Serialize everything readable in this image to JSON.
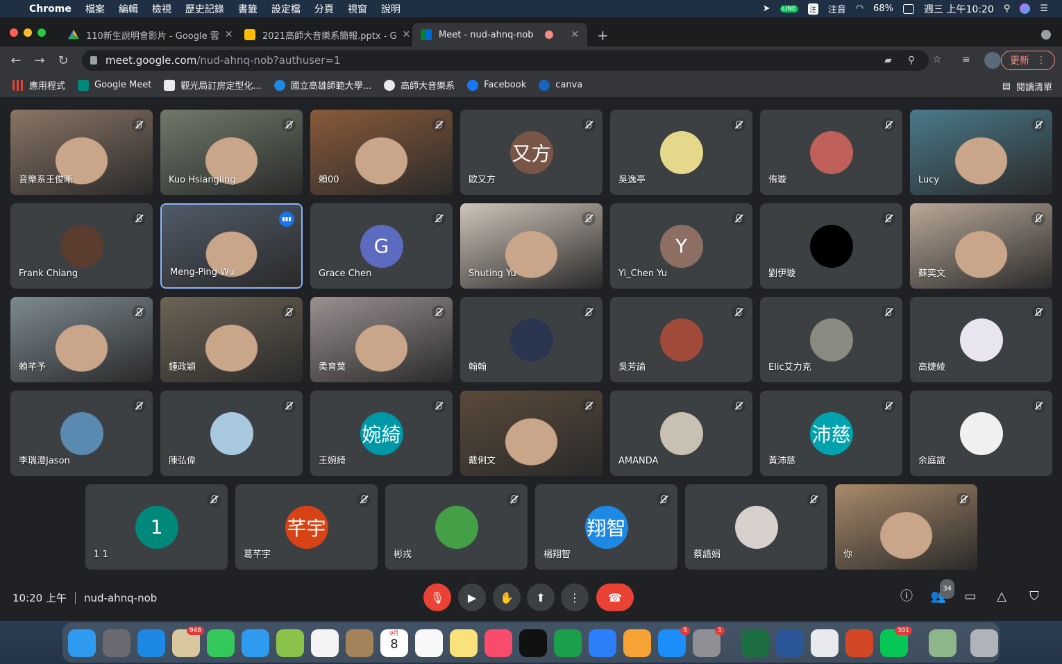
{
  "menubar": {
    "app": "Chrome",
    "menus": [
      "檔案",
      "編輯",
      "檢視",
      "歷史記錄",
      "書籤",
      "設定檔",
      "分頁",
      "視窗",
      "說明"
    ],
    "input_method": "注音",
    "battery": "68%",
    "clock": "週三 上午10:20"
  },
  "tabs": [
    {
      "title": "110新生說明會影片 - Google 雲",
      "icon": "google-drive-icon"
    },
    {
      "title": "2021高師大音樂系簡報.pptx - G",
      "icon": "google-slides-icon"
    },
    {
      "title": "Meet - nud-ahnq-nob",
      "icon": "google-meet-icon"
    }
  ],
  "omnibox": {
    "host": "meet.google.com",
    "path": "/nud-ahnq-nob?authuser=1"
  },
  "update_label": "更新",
  "bookmarks": [
    {
      "label": "應用程式",
      "color": "#ea4335"
    },
    {
      "label": "Google Meet",
      "color": "#00897b"
    },
    {
      "label": "觀光局訂房定型化...",
      "color": "#e8eaed"
    },
    {
      "label": "國立高雄師範大學...",
      "color": "#1e88e5"
    },
    {
      "label": "高師大音樂系",
      "color": "#e8eaed"
    },
    {
      "label": "Facebook",
      "color": "#1877f2"
    },
    {
      "label": "canva",
      "color": "#1565c0"
    }
  ],
  "reading_list": "閱讀清單",
  "participants": [
    {
      "name": "音樂系王俊晰",
      "type": "video",
      "bg": "#8a7566"
    },
    {
      "name": "Kuo Hsiangling",
      "type": "video",
      "bg": "#6f7a6a"
    },
    {
      "name": "賴00",
      "type": "video",
      "bg": "#8a5a3a"
    },
    {
      "name": "歐又方",
      "type": "avatar",
      "initial": "又方",
      "bg": "#795548"
    },
    {
      "name": "吳逸亭",
      "type": "avatar",
      "initial": "",
      "bg": "#e6d88a"
    },
    {
      "name": "侑璇",
      "type": "avatar",
      "initial": "",
      "bg": "#c0605a"
    },
    {
      "name": "Lucy",
      "type": "video",
      "bg": "#4a7a8a"
    },
    {
      "name": "Frank Chiang",
      "type": "avatar",
      "initial": "",
      "bg": "#5a3d2e"
    },
    {
      "name": "Meng-Ping Wu",
      "type": "video",
      "bg": "#505a68",
      "speaking": true
    },
    {
      "name": "Grace Chen",
      "type": "avatar",
      "initial": "G",
      "bg": "#5c6bc0"
    },
    {
      "name": "Shuting Yu",
      "type": "video",
      "bg": "#cfc4b8"
    },
    {
      "name": "Yi_Chen Yu",
      "type": "avatar",
      "initial": "Y",
      "bg": "#8d6e63"
    },
    {
      "name": "劉伊璇",
      "type": "avatar",
      "initial": "",
      "bg": "#000000"
    },
    {
      "name": "蘇奕文",
      "type": "video",
      "bg": "#b9a898"
    },
    {
      "name": "賴芊予",
      "type": "video",
      "bg": "#7d8a92"
    },
    {
      "name": "鍾政穎",
      "type": "video",
      "bg": "#6d6355"
    },
    {
      "name": "柔育葉",
      "type": "video",
      "bg": "#9a9090"
    },
    {
      "name": "翰翰",
      "type": "avatar",
      "initial": "",
      "bg": "#2a3550"
    },
    {
      "name": "吳芳諭",
      "type": "avatar",
      "initial": "",
      "bg": "#a04a3a"
    },
    {
      "name": "Elic艾力克",
      "type": "avatar",
      "initial": "",
      "bg": "#8a8a80"
    },
    {
      "name": "高婕綾",
      "type": "avatar",
      "initial": "",
      "bg": "#e8e4f0"
    },
    {
      "name": "李瑞澄Jason",
      "type": "avatar",
      "initial": "",
      "bg": "#5a8ab0"
    },
    {
      "name": "陳弘偉",
      "type": "avatar",
      "initial": "",
      "bg": "#a8c8e0"
    },
    {
      "name": "王婉綺",
      "type": "avatar",
      "initial": "婉綺",
      "bg": "#0097a7"
    },
    {
      "name": "戴俐文",
      "type": "video",
      "bg": "#5a4a3a"
    },
    {
      "name": "AMANDA",
      "type": "avatar",
      "initial": "",
      "bg": "#c8c0b0"
    },
    {
      "name": "黃沛慈",
      "type": "avatar",
      "initial": "沛慈",
      "bg": "#00a2ad"
    },
    {
      "name": "余庭誼",
      "type": "avatar",
      "initial": "",
      "bg": "#f0f0f0"
    },
    {
      "name": "1 1",
      "type": "avatar",
      "initial": "1",
      "bg": "#00897b"
    },
    {
      "name": "葛芊宇",
      "type": "avatar",
      "initial": "芊宇",
      "bg": "#d84315"
    },
    {
      "name": "彬戎",
      "type": "avatar",
      "initial": "",
      "bg": "#43a047"
    },
    {
      "name": "楊翔智",
      "type": "avatar",
      "initial": "翔智",
      "bg": "#1e88e5"
    },
    {
      "name": "蔡語娟",
      "type": "avatar",
      "initial": "",
      "bg": "#d8d0cc"
    },
    {
      "name": "你",
      "type": "video",
      "bg": "#a88a6a"
    }
  ],
  "bottom": {
    "time": "10:20 上午",
    "code": "nud-ahnq-nob",
    "people_count": "34"
  },
  "dock": [
    {
      "name": "finder-icon",
      "color": "#2e9bf0"
    },
    {
      "name": "launchpad-icon",
      "color": "#6a6a70"
    },
    {
      "name": "safari-icon",
      "color": "#1e88e5"
    },
    {
      "name": "mail-icon",
      "color": "#d9c7a0",
      "badge": "948"
    },
    {
      "name": "facetime-icon",
      "color": "#34c759"
    },
    {
      "name": "messages-icon",
      "color": "#2e9bf0"
    },
    {
      "name": "maps-icon",
      "color": "#8bc34a"
    },
    {
      "name": "photos-icon",
      "color": "#f4f4f4"
    },
    {
      "name": "contacts-icon",
      "color": "#a5835a"
    },
    {
      "name": "calendar-icon",
      "color": "#ffffff",
      "label": "8",
      "month": "9月"
    },
    {
      "name": "reminders-icon",
      "color": "#f8f8f8"
    },
    {
      "name": "notes-icon",
      "color": "#f9e27a"
    },
    {
      "name": "music-icon",
      "color": "#f94c6c"
    },
    {
      "name": "tv-icon",
      "color": "#111111"
    },
    {
      "name": "numbers-icon",
      "color": "#1a9f4b"
    },
    {
      "name": "keynote-icon",
      "color": "#2d7ff9"
    },
    {
      "name": "pages-icon",
      "color": "#f7a234"
    },
    {
      "name": "app-store-icon",
      "color": "#1c8ef9",
      "badge": "5"
    },
    {
      "name": "system-preferences-icon",
      "color": "#8e8e93",
      "badge": "1"
    },
    {
      "name": "excel-icon",
      "color": "#1d6f42"
    },
    {
      "name": "word-icon",
      "color": "#2b579a"
    },
    {
      "name": "chrome-icon",
      "color": "#e8eaed"
    },
    {
      "name": "powerpoint-icon",
      "color": "#d24726"
    },
    {
      "name": "line-icon",
      "color": "#06c755",
      "badge": "301"
    },
    {
      "name": "preview-icon",
      "color": "#8fb58a"
    },
    {
      "name": "trash-icon",
      "color": "#b0b4b8"
    }
  ]
}
